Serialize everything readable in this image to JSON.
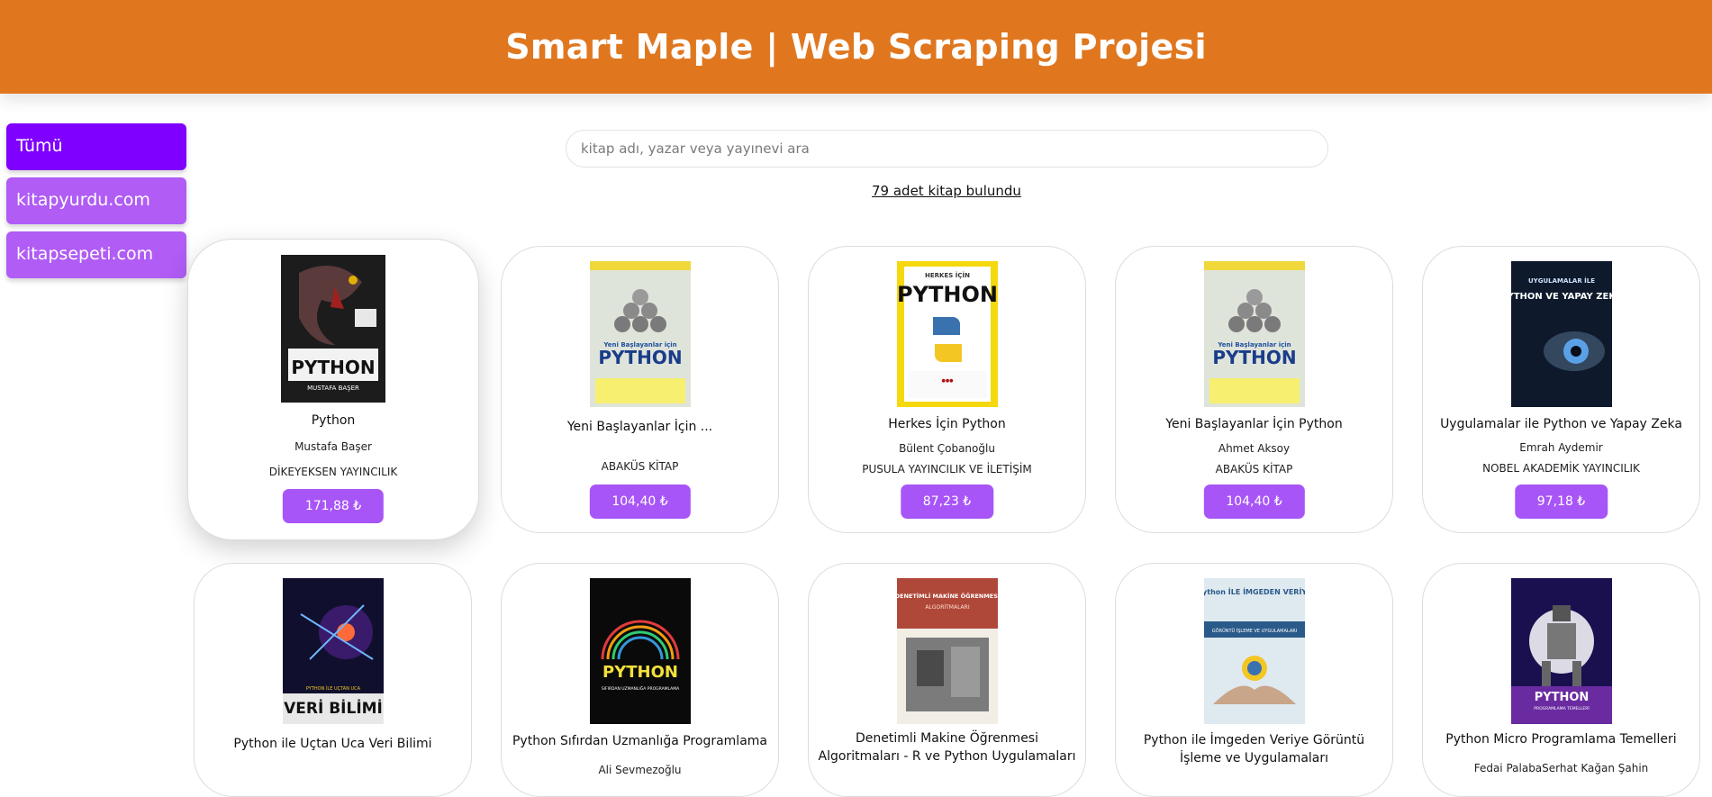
{
  "header": {
    "title": "Smart Maple | Web Scraping Projesi"
  },
  "sidebar": {
    "items": [
      {
        "label": "Tümü",
        "active": true
      },
      {
        "label": "kitapyurdu.com",
        "active": false
      },
      {
        "label": "kitapsepeti.com",
        "active": false
      }
    ]
  },
  "search": {
    "placeholder": "kitap adı, yazar veya yayınevi ara",
    "value": ""
  },
  "result_count": "79 adet kitap bulundu",
  "colors": {
    "header": "#e0771f",
    "active": "#7f00ff",
    "secondary": "#b05cf5",
    "price": "#a855f7"
  },
  "books": [
    {
      "title": "Python",
      "author": "Mustafa Başer",
      "publisher": "DİKEYEKSEN YAYINCILIK",
      "price": "171,88 ₺"
    },
    {
      "title": "Yeni Başlayanlar İçin ...",
      "author": "",
      "publisher": "ABAKÜS KİTAP",
      "price": "104,40 ₺"
    },
    {
      "title": "Herkes İçin Python",
      "author": "Bülent Çobanoğlu",
      "publisher": "PUSULA YAYINCILIK VE İLETİŞİM",
      "price": "87,23 ₺"
    },
    {
      "title": "Yeni Başlayanlar İçin Python",
      "author": "Ahmet Aksoy",
      "publisher": "ABAKÜS KİTAP",
      "price": "104,40 ₺"
    },
    {
      "title": "Uygulamalar ile Python ve Yapay Zeka",
      "author": "Emrah Aydemir",
      "publisher": "NOBEL AKADEMİK YAYINCILIK",
      "price": "97,18 ₺"
    },
    {
      "title": "Python ile Uçtan Uca Veri Bilimi",
      "author": "",
      "publisher": "",
      "price": ""
    },
    {
      "title": "Python Sıfırdan Uzmanlığa Programlama",
      "author": "Ali Sevmezoğlu",
      "publisher": "",
      "price": ""
    },
    {
      "title": "Denetimli Makine Öğrenmesi Algoritmaları - R ve Python Uygulamaları",
      "author": "",
      "publisher": "",
      "price": ""
    },
    {
      "title": "Python ile İmgeden Veriye Görüntü İşleme ve Uygulamaları",
      "author": "",
      "publisher": "",
      "price": ""
    },
    {
      "title": "Python Micro Programlama Temelleri",
      "author": "Fedai PalabaSerhat Kağan Şahin",
      "publisher": "",
      "price": ""
    }
  ],
  "covers": [
    {
      "cover_text": "PYTHON",
      "cover_sub": "MUSTAFA BAŞER",
      "icon": "snake-cover-icon"
    },
    {
      "cover_text": "PYTHON",
      "cover_sub": "Yeni Başlayanlar için",
      "icon": "spheres-cover-icon"
    },
    {
      "cover_text": "PYTHON",
      "cover_sub": "HERKES İÇİN",
      "icon": "python-logo-cover-icon"
    },
    {
      "cover_text": "PYTHON",
      "cover_sub": "Yeni Başlayanlar için",
      "icon": "spheres-cover-icon"
    },
    {
      "cover_text": "PYTHON VE YAPAY ZEKA",
      "cover_sub": "UYGULAMALAR İLE",
      "icon": "eye-cover-icon"
    },
    {
      "cover_text": "VERİ BİLİMİ",
      "cover_sub": "PYTHON İLE UÇTAN UCA",
      "icon": "galaxy-cover-icon"
    },
    {
      "cover_text": "PYTHON",
      "cover_sub": "SIFIRDAN UZMANLIĞA PROGRAMLAMA",
      "icon": "rainbow-cover-icon"
    },
    {
      "cover_text": "DENETİMLİ MAKİNE ÖĞRENMESİ",
      "cover_sub": "ALGORİTMALARI",
      "icon": "machine-cover-icon"
    },
    {
      "cover_text": "python İLE İMGEDEN VERİYE",
      "cover_sub": "GÖRÜNTÜ İŞLEME VE UYGULAMALARI",
      "icon": "hands-cover-icon"
    },
    {
      "cover_text": "PYTHON",
      "cover_sub": "PROGRAMLAMA TEMELLERİ",
      "icon": "robot-cover-icon"
    }
  ]
}
